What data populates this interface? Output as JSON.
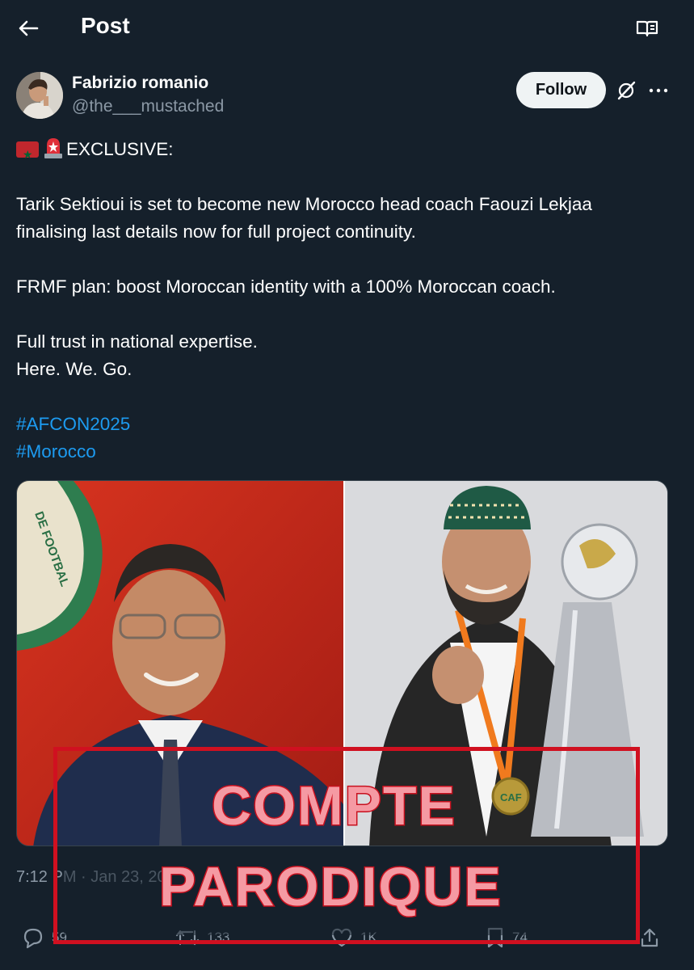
{
  "header": {
    "title": "Post",
    "back_icon": "arrow-left-icon",
    "reader_icon": "book-open-icon"
  },
  "author": {
    "name": "Fabrizio romanio",
    "handle": "@the___mustached",
    "follow_label": "Follow"
  },
  "post": {
    "line_exclusive": "EXCLUSIVE:",
    "para1_line1": "Tarik Sektioui is set to become new Morocco head coach Faouzi Lekjaa",
    "para1_line2": "finalising last details now for full project continuity.",
    "para2": "FRMF plan: boost Moroccan identity with a 100% Moroccan coach.",
    "para3_line1": "Full trust in national expertise.",
    "para3_line2": "Here. We. Go.",
    "hashtags": [
      "#AFCON2025",
      "#Morocco"
    ],
    "emoji": [
      "morocco-flag",
      "siren"
    ]
  },
  "media": {
    "left_text": "DE FOOTBAL",
    "right_text": "CAF"
  },
  "timestamp": "7:12 PM · Jan 23, 20",
  "actions": {
    "reply_count": "59",
    "repost_count": "133",
    "like_count": "1K",
    "bookmark_count": "74"
  },
  "overlay": {
    "line1": "COMPTE",
    "line2": "PARODIQUE"
  },
  "colors": {
    "background": "#15202b",
    "accent": "#1d9bf0",
    "muted": "#8b98a5",
    "stamp": "#d01020"
  }
}
